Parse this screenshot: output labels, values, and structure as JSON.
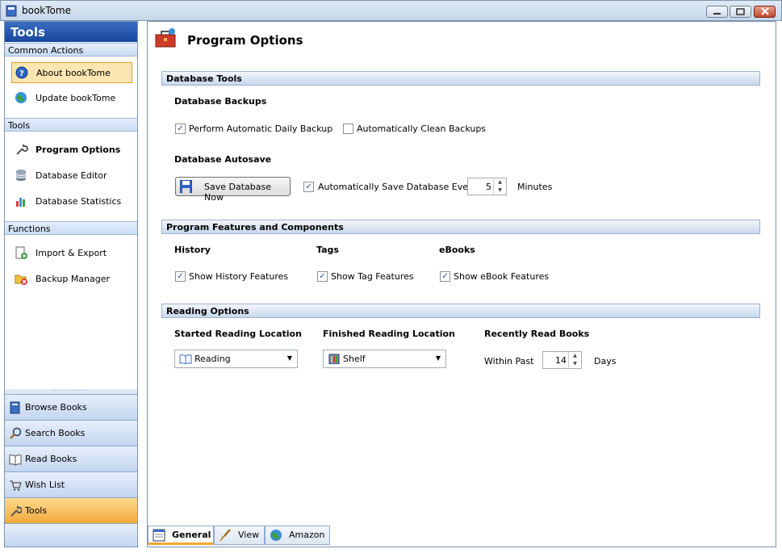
{
  "window": {
    "title": "bookTome"
  },
  "left": {
    "header": "Tools",
    "sections": {
      "common": "Common Actions",
      "tools": "Tools",
      "functions": "Functions"
    },
    "common_items": [
      "About bookTome",
      "Update bookTome"
    ],
    "tools_items": [
      "Program Options",
      "Database Editor",
      "Database Statistics"
    ],
    "function_items": [
      "Import & Export",
      "Backup Manager"
    ],
    "nav": [
      "Browse Books",
      "Search Books",
      "Read Books",
      "Wish List",
      "Tools"
    ]
  },
  "main": {
    "title": "Program Options",
    "db_tools": {
      "header": "Database Tools",
      "backups_label": "Database Backups",
      "auto_backup": "Perform Automatic Daily Backup",
      "auto_backup_checked": true,
      "clean_backups": "Automatically Clean Backups",
      "clean_backups_checked": false,
      "autosave_label": "Database Autosave",
      "save_now": "Save Database Now",
      "auto_save": "Automatically Save Database Every",
      "auto_save_checked": true,
      "minutes_value": "5",
      "minutes_label": "Minutes"
    },
    "features": {
      "header": "Program Features and Components",
      "history_label": "History",
      "history_cb": "Show History Features",
      "tags_label": "Tags",
      "tags_cb": "Show Tag Features",
      "ebooks_label": "eBooks",
      "ebooks_cb": "Show eBook Features"
    },
    "reading": {
      "header": "Reading Options",
      "started_label": "Started Reading Location",
      "started_value": "Reading",
      "finished_label": "Finished Reading Location",
      "finished_value": "Shelf",
      "recent_label": "Recently Read Books",
      "within": "Within Past",
      "days_value": "14",
      "days_label": "Days"
    },
    "tabs": [
      "General",
      "View",
      "Amazon"
    ]
  },
  "colors": {
    "accent": "#18479c",
    "selected": "#f2a93a"
  }
}
